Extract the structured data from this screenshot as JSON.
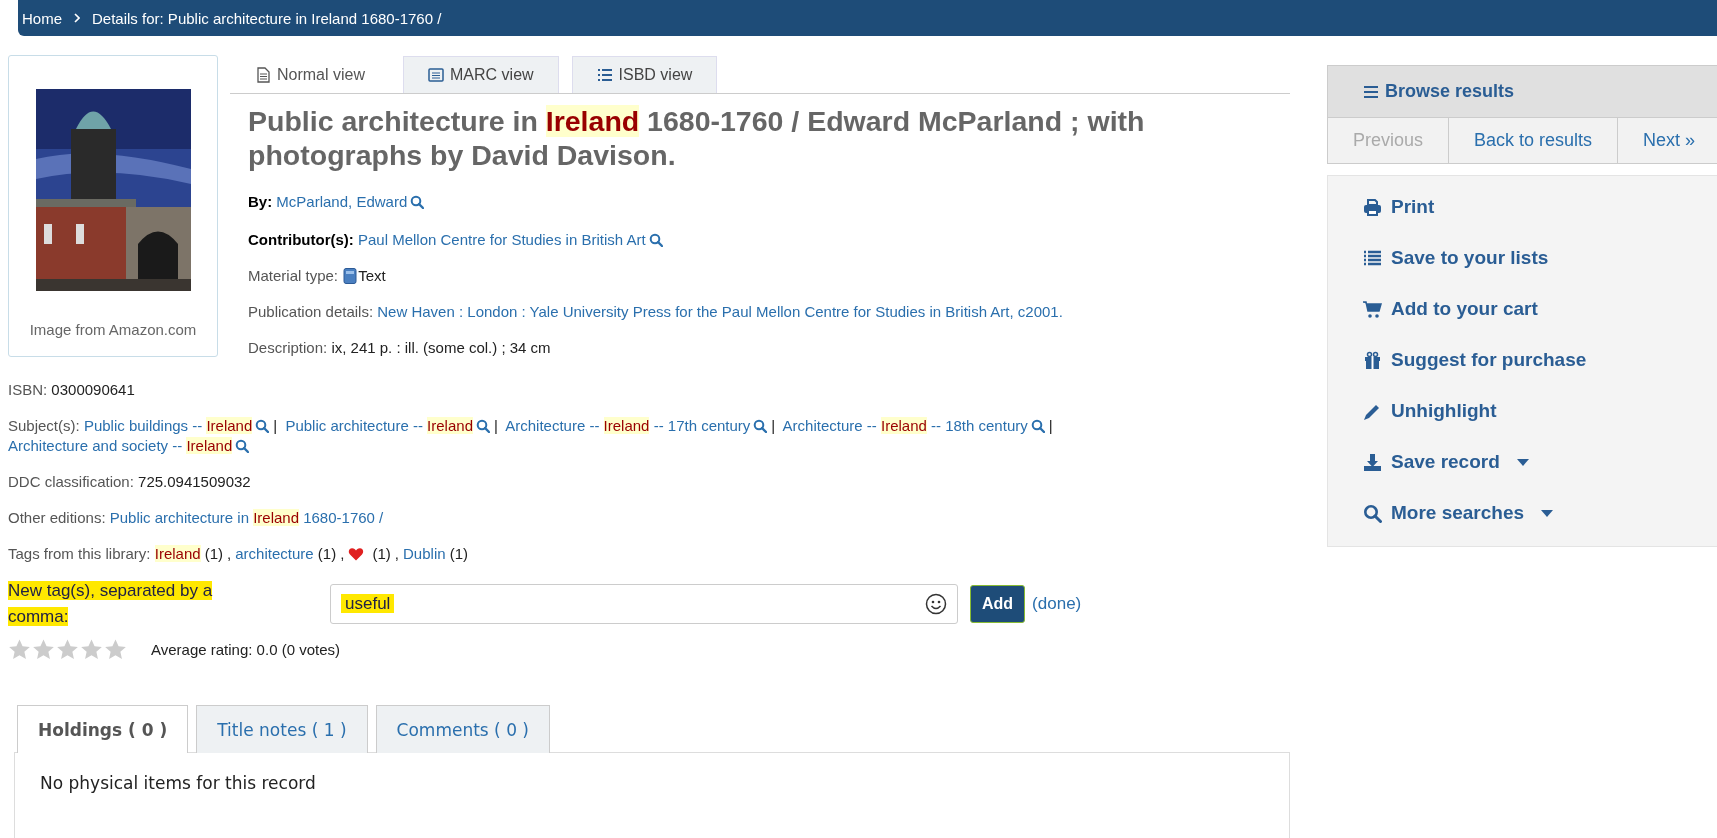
{
  "breadcrumb": [
    {
      "label": "Home"
    },
    {
      "label": "Details for: Public architecture in Ireland 1680-1760 /"
    }
  ],
  "cover": {
    "kind": "picture",
    "caption": "Image from Amazon.com"
  },
  "view_tabs": [
    {
      "kind": "normal",
      "label": "Normal view",
      "selected": true
    },
    {
      "kind": "marc",
      "label": "MARC view",
      "selected": false
    },
    {
      "kind": "isbd",
      "label": "ISBD view",
      "selected": false
    }
  ],
  "title": [
    {
      "text": "Public architecture in ",
      "highlight": false
    },
    {
      "text": "Ireland",
      "highlight": true
    },
    {
      "text": " 1680-1760 / Edward McParland ; with photographs by David Davison.",
      "highlight": false
    }
  ],
  "details": [
    {
      "kind": "links",
      "label": "By:",
      "emphasis": true,
      "links": [
        {
          "parts": [
            {
              "text": "McParland, Edward",
              "highlight": false
            }
          ],
          "search": true
        }
      ]
    },
    {
      "kind": "links",
      "label": "Contributor(s):",
      "emphasis": true,
      "links": [
        {
          "parts": [
            {
              "text": "Paul Mellon Centre for Studies in British Art",
              "highlight": false
            }
          ],
          "search": true
        }
      ]
    },
    {
      "kind": "material",
      "label": "Material type:",
      "emphasis": false,
      "value": "Text"
    },
    {
      "kind": "links",
      "label": "Publication details:",
      "emphasis": false,
      "links": [
        {
          "parts": [
            {
              "text": "New Haven : London : Yale University Press for the Paul Mellon Centre for Studies in British Art, c2001.",
              "highlight": false
            }
          ],
          "search": false
        }
      ]
    },
    {
      "kind": "value",
      "label": "Description:",
      "emphasis": false,
      "value": "ix, 241 p. : ill. (some col.) ; 34 cm"
    }
  ],
  "more_details": [
    {
      "kind": "value",
      "label": "ISBN:",
      "emphasis": false,
      "value": "0300090641"
    },
    {
      "kind": "links",
      "label": "Subject(s):",
      "emphasis": false,
      "separator": "|",
      "links": [
        {
          "parts": [
            {
              "text": "Public buildings -- ",
              "highlight": false
            },
            {
              "text": "Ireland",
              "highlight": true
            }
          ],
          "search": true
        },
        {
          "parts": [
            {
              "text": "Public architecture -- ",
              "highlight": false
            },
            {
              "text": "Ireland",
              "highlight": true
            }
          ],
          "search": true
        },
        {
          "parts": [
            {
              "text": "Architecture -- ",
              "highlight": false
            },
            {
              "text": "Ireland",
              "highlight": true
            },
            {
              "text": " -- 17th century",
              "highlight": false
            }
          ],
          "search": true
        },
        {
          "parts": [
            {
              "text": "Architecture -- ",
              "highlight": false
            },
            {
              "text": "Ireland",
              "highlight": true
            },
            {
              "text": " -- 18th century",
              "highlight": false
            }
          ],
          "search": true
        },
        {
          "parts": [
            {
              "text": "Architecture and society -- ",
              "highlight": false
            },
            {
              "text": "Ireland",
              "highlight": true
            }
          ],
          "search": true
        }
      ]
    },
    {
      "kind": "value",
      "label": "DDC classification:",
      "emphasis": false,
      "value": "725.0941509032"
    },
    {
      "kind": "links",
      "label": "Other editions:",
      "emphasis": false,
      "links": [
        {
          "parts": [
            {
              "text": "Public architecture in ",
              "highlight": false
            },
            {
              "text": "Ireland",
              "highlight": true
            },
            {
              "text": " 1680-1760 /",
              "highlight": false
            }
          ],
          "search": false
        }
      ]
    },
    {
      "kind": "tags",
      "label": "Tags from this library:",
      "emphasis": false,
      "separator": ",",
      "tags": [
        {
          "kind": "link",
          "parts": [
            {
              "text": "Ireland",
              "highlight": true
            }
          ],
          "count": "(1)"
        },
        {
          "kind": "link",
          "parts": [
            {
              "text": "architecture",
              "highlight": false
            }
          ],
          "count": "(1)"
        },
        {
          "kind": "heart",
          "count": "(1)"
        },
        {
          "kind": "link",
          "parts": [
            {
              "text": "Dublin",
              "highlight": false
            }
          ],
          "count": "(1)"
        }
      ]
    }
  ],
  "tag_form": {
    "label": "New tag(s), separated by a comma:",
    "label_marked": true,
    "value": "useful",
    "value_marked": true,
    "button": "Add",
    "done": "(done)"
  },
  "rating": {
    "stars": 0,
    "summary": "Average rating: 0.0 (0 votes)"
  },
  "browse": {
    "title": "Browse results",
    "pager": [
      {
        "label": "Previous",
        "disabled": true
      },
      {
        "label": "Back to results",
        "disabled": false
      },
      {
        "label": "Next »",
        "disabled": false
      }
    ]
  },
  "actions": [
    {
      "kind": "print",
      "label": "Print",
      "dropdown": false
    },
    {
      "kind": "list",
      "label": "Save to your lists",
      "dropdown": false
    },
    {
      "kind": "cart",
      "label": "Add to your cart",
      "dropdown": false
    },
    {
      "kind": "gift",
      "label": "Suggest for purchase",
      "dropdown": false
    },
    {
      "kind": "pencil",
      "label": "Unhighlight",
      "dropdown": false
    },
    {
      "kind": "download",
      "label": "Save record",
      "dropdown": true
    },
    {
      "kind": "search",
      "label": "More searches",
      "dropdown": true
    }
  ],
  "bottom_tabs": [
    {
      "label": "Holdings ( 0 )",
      "selected": true
    },
    {
      "label": "Title notes ( 1 )",
      "selected": false
    },
    {
      "label": "Comments ( 0 )",
      "selected": false
    }
  ],
  "panel_text": "No physical items for this record"
}
